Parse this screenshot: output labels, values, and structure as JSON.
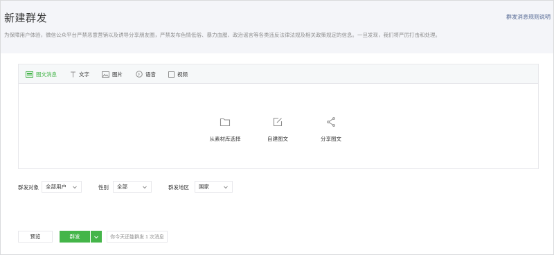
{
  "header": {
    "title": "新建群发",
    "rules_link": "群发消息规则说明",
    "notice": "为保障用户体验，微信公众平台严禁恶意营销以及诱导分享朋友圈，严禁发布色情低俗、暴力血腥、政治谣言等各类违反法律法规及相关政策规定的信息。一旦发现，我们将严厉打击和处理。"
  },
  "editor": {
    "tabs": [
      {
        "label": "图文消息",
        "icon": "article-icon",
        "active": true
      },
      {
        "label": "文字",
        "icon": "text-icon",
        "active": false
      },
      {
        "label": "图片",
        "icon": "image-icon",
        "active": false
      },
      {
        "label": "语音",
        "icon": "voice-icon",
        "active": false
      },
      {
        "label": "视频",
        "icon": "video-icon",
        "active": false
      }
    ],
    "choices": [
      {
        "label": "从素材库选择",
        "icon": "folder-icon"
      },
      {
        "label": "自建图文",
        "icon": "edit-icon"
      },
      {
        "label": "分享图文",
        "icon": "share-icon"
      }
    ]
  },
  "filters": {
    "target_label": "群发对象",
    "target_value": "全部用户",
    "gender_label": "性别",
    "gender_value": "全部",
    "region_label": "群发地区",
    "region_value": "国家"
  },
  "actions": {
    "preview_label": "预览",
    "send_label": "群发",
    "quota_text": "你今天还能群发 1 次消息"
  },
  "colors": {
    "accent": "#44b549",
    "link": "#576b95",
    "header_bg": "#f4f5f9",
    "border": "#e7e7eb"
  }
}
